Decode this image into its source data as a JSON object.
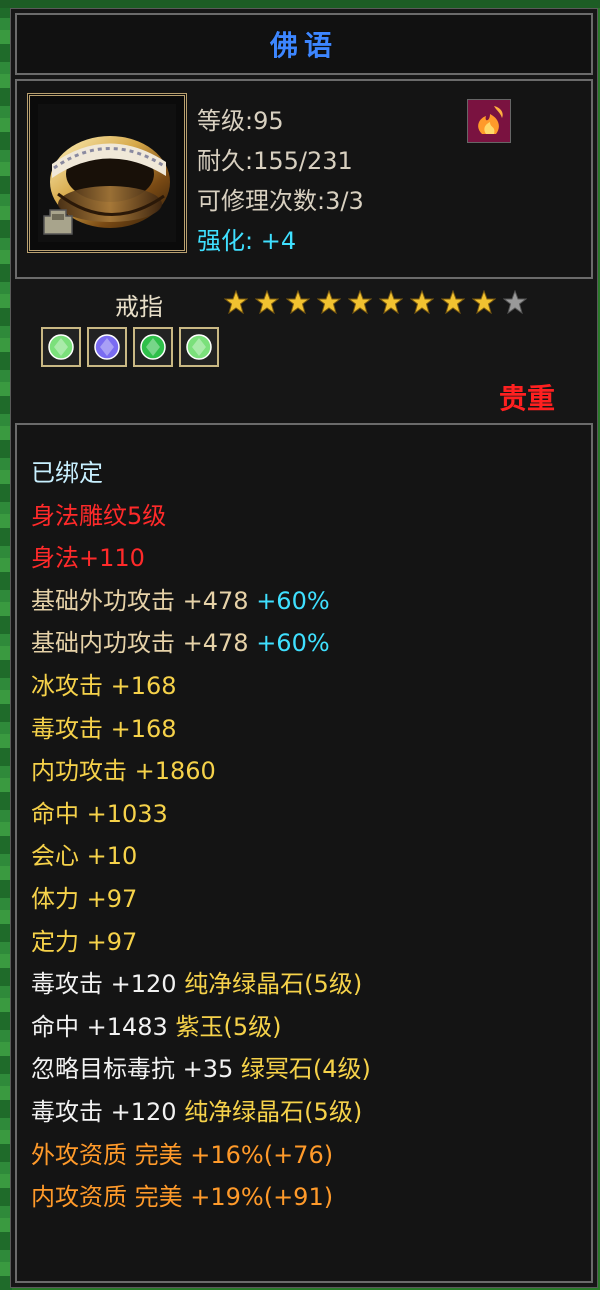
{
  "title": "佛语",
  "item": {
    "level_label": "等级:95",
    "durability_label": "耐久:155/231",
    "repair_label": "可修理次数:3/3",
    "enhance_label": "强化: ",
    "enhance_value": "+4",
    "type": "戒指",
    "stars_filled": 9,
    "stars_total": 10,
    "rarity": "贵重"
  },
  "gems": [
    {
      "name": "green-gem-icon",
      "color": "#7be07b"
    },
    {
      "name": "purple-gem-icon",
      "color": "#7a6cf2"
    },
    {
      "name": "emerald-gem-icon",
      "color": "#2fc04a"
    },
    {
      "name": "green-gem-icon",
      "color": "#7be07b"
    }
  ],
  "properties": [
    {
      "segments": [
        {
          "text": "已绑定",
          "color": "bound"
        }
      ]
    },
    {
      "segments": [
        {
          "text": "身法雕纹5级",
          "color": "red"
        }
      ]
    },
    {
      "segments": [
        {
          "text": "身法+110",
          "color": "red"
        }
      ]
    },
    {
      "segments": [
        {
          "text": "基础外功攻击 +478 ",
          "color": "tan"
        },
        {
          "text": "+60%",
          "color": "cyan"
        }
      ]
    },
    {
      "segments": [
        {
          "text": "基础内功攻击 +478 ",
          "color": "tan"
        },
        {
          "text": "+60%",
          "color": "cyan"
        }
      ]
    },
    {
      "segments": [
        {
          "text": "冰攻击 +168",
          "color": "yellow"
        }
      ]
    },
    {
      "segments": [
        {
          "text": "毒攻击 +168",
          "color": "yellow"
        }
      ]
    },
    {
      "segments": [
        {
          "text": "内功攻击 +1860",
          "color": "yellow"
        }
      ]
    },
    {
      "segments": [
        {
          "text": "命中 +1033",
          "color": "yellow"
        }
      ]
    },
    {
      "segments": [
        {
          "text": "会心 +10",
          "color": "yellow"
        }
      ]
    },
    {
      "segments": [
        {
          "text": "体力 +97",
          "color": "yellow"
        }
      ]
    },
    {
      "segments": [
        {
          "text": "定力 +97",
          "color": "yellow"
        }
      ]
    },
    {
      "segments": [
        {
          "text": "毒攻击 +120 ",
          "color": "white"
        },
        {
          "text": "纯净绿晶石(5级)",
          "color": "yellow"
        }
      ]
    },
    {
      "segments": [
        {
          "text": "命中 +1483 ",
          "color": "white"
        },
        {
          "text": "紫玉(5级)",
          "color": "yellow"
        }
      ]
    },
    {
      "segments": [
        {
          "text": "忽略目标毒抗 +35 ",
          "color": "white"
        },
        {
          "text": "绿冥石(4级)",
          "color": "yellow"
        }
      ]
    },
    {
      "segments": [
        {
          "text": "毒攻击 +120 ",
          "color": "white"
        },
        {
          "text": "纯净绿晶石(5级)",
          "color": "yellow"
        }
      ]
    },
    {
      "segments": [
        {
          "text": "外攻资质  完美 +16%(+76)",
          "color": "orange"
        }
      ]
    },
    {
      "segments": [
        {
          "text": "内攻资质  完美 +19%(+91)",
          "color": "orange"
        }
      ]
    }
  ]
}
